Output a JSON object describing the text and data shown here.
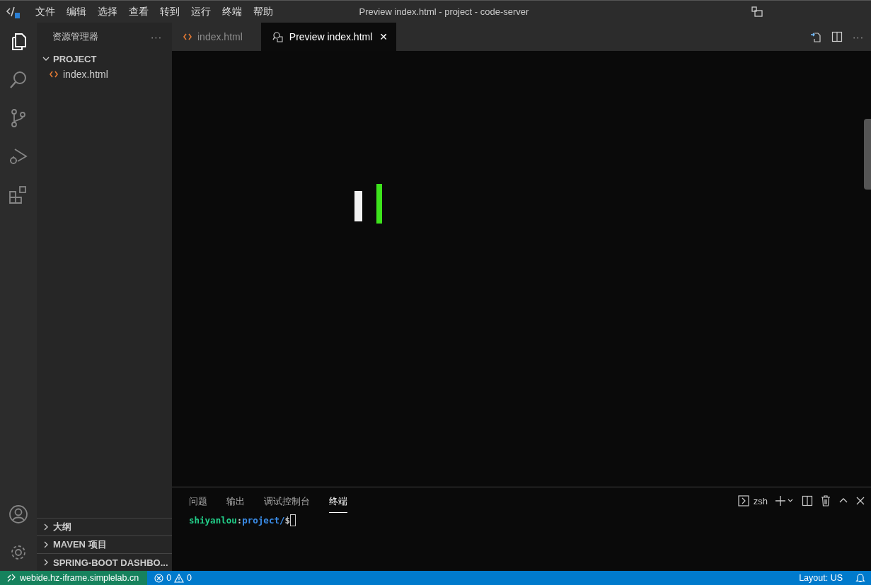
{
  "window": {
    "title": "Preview index.html - project - code-server"
  },
  "menu": [
    "文件",
    "编辑",
    "选择",
    "查看",
    "转到",
    "运行",
    "终端",
    "帮助"
  ],
  "activity_bar": [
    {
      "kind": "files",
      "selected": true
    },
    {
      "kind": "search",
      "selected": false
    },
    {
      "kind": "source-control",
      "selected": false
    },
    {
      "kind": "run-debug",
      "selected": false
    },
    {
      "kind": "extensions",
      "selected": false
    }
  ],
  "sidebar": {
    "title": "资源管理器",
    "more": "···",
    "sections": [
      {
        "label": "PROJECT",
        "expanded": true,
        "children": [
          {
            "label": "index.html",
            "kind": "html"
          }
        ]
      }
    ],
    "bottom_sections": [
      {
        "label": "大纲",
        "expanded": false
      },
      {
        "label": "MAVEN 项目",
        "expanded": false
      },
      {
        "label": "SPRING-BOOT DASHBO...",
        "expanded": false
      }
    ]
  },
  "tabs": [
    {
      "label": "index.html",
      "kind": "html",
      "selected": false
    },
    {
      "label": "Preview index.html",
      "kind": "preview",
      "selected": true,
      "close": "✕"
    }
  ],
  "preview": {
    "bars": [
      {
        "color": "#f2f2f2"
      },
      {
        "color": "#3de31c"
      }
    ]
  },
  "panel": {
    "tabs": [
      {
        "label": "问题",
        "selected": false
      },
      {
        "label": "输出",
        "selected": false
      },
      {
        "label": "调试控制台",
        "selected": false
      },
      {
        "label": "终端",
        "selected": true
      }
    ],
    "shell": "zsh",
    "prompt": {
      "user": "shiyanlou",
      "sep": ":",
      "path": "project/",
      "symbol": "$"
    }
  },
  "status_bar": {
    "remote": "webide.hz-iframe.simplelab.cn",
    "errors": "0",
    "warnings": "0",
    "layout": "Layout: US"
  }
}
